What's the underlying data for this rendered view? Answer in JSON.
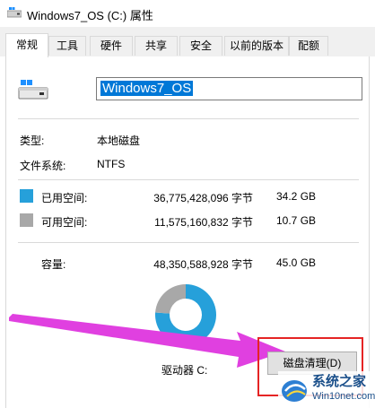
{
  "window": {
    "title": "Windows7_OS (C:) 属性"
  },
  "tabs": [
    {
      "label": "常规",
      "active": true
    },
    {
      "label": "工具"
    },
    {
      "label": "硬件"
    },
    {
      "label": "共享"
    },
    {
      "label": "安全"
    },
    {
      "label": "以前的版本"
    },
    {
      "label": "配额"
    }
  ],
  "drive": {
    "name": "Windows7_OS"
  },
  "info": {
    "type_label": "类型:",
    "type_value": "本地磁盘",
    "fs_label": "文件系统:",
    "fs_value": "NTFS"
  },
  "space": {
    "used_label": "已用空间:",
    "used_bytes": "36,775,428,096 字节",
    "used_size": "34.2 GB",
    "used_color": "#26a0da",
    "free_label": "可用空间:",
    "free_bytes": "11,575,160,832 字节",
    "free_size": "10.7 GB",
    "free_color": "#a8a8a8",
    "capacity_label": "容量:",
    "capacity_bytes": "48,350,588,928 字节",
    "capacity_size": "45.0 GB"
  },
  "chart_data": {
    "type": "pie",
    "categories": [
      "已用空间",
      "可用空间"
    ],
    "values": [
      34.2,
      10.7
    ]
  },
  "drive_letter": "驱动器 C:",
  "buttons": {
    "disk_cleanup": "磁盘清理(D)"
  },
  "annotation": {
    "arrow_color": "#e040e0",
    "box_color": "#e52424"
  },
  "watermark": {
    "title": "系统之家",
    "url": "Win10net.com"
  }
}
